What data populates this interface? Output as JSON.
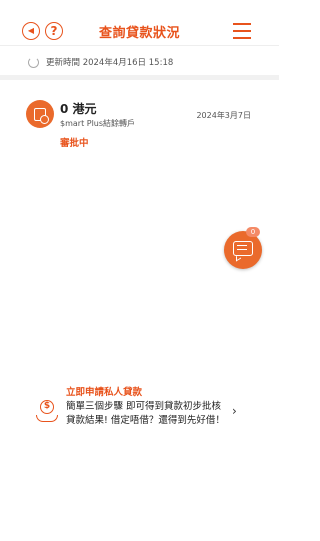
{
  "header": {
    "back_icon": "back-arrow-icon",
    "back_glyph": "◀",
    "help_icon": "question-icon",
    "help_glyph": "?",
    "title": "查詢貸款狀況",
    "menu_icon": "hamburger-menu-icon"
  },
  "update_bar": {
    "icon": "refresh-icon",
    "text": "更新時間 2024年4月16日 15:18"
  },
  "loans": [
    {
      "icon": "document-loan-icon",
      "amount": "0 港元",
      "product": "$mart Plus結餘轉戶",
      "date": "2024年3月7日",
      "status": "審批中"
    }
  ],
  "chat": {
    "icon": "chat-bubble-icon",
    "badge": "0"
  },
  "promo": {
    "title": "立即申請私人貸款",
    "icon": "money-hand-icon",
    "coin_glyph": "$",
    "text": "簡單三個步驟 即可得到貸款初步批核貸款結果! 借定唔借？還得到先好借！",
    "chevron": "›"
  },
  "colors": {
    "accent": "#e8531c",
    "icon_bg": "#ea6a2c",
    "badge": "#f48a66"
  }
}
